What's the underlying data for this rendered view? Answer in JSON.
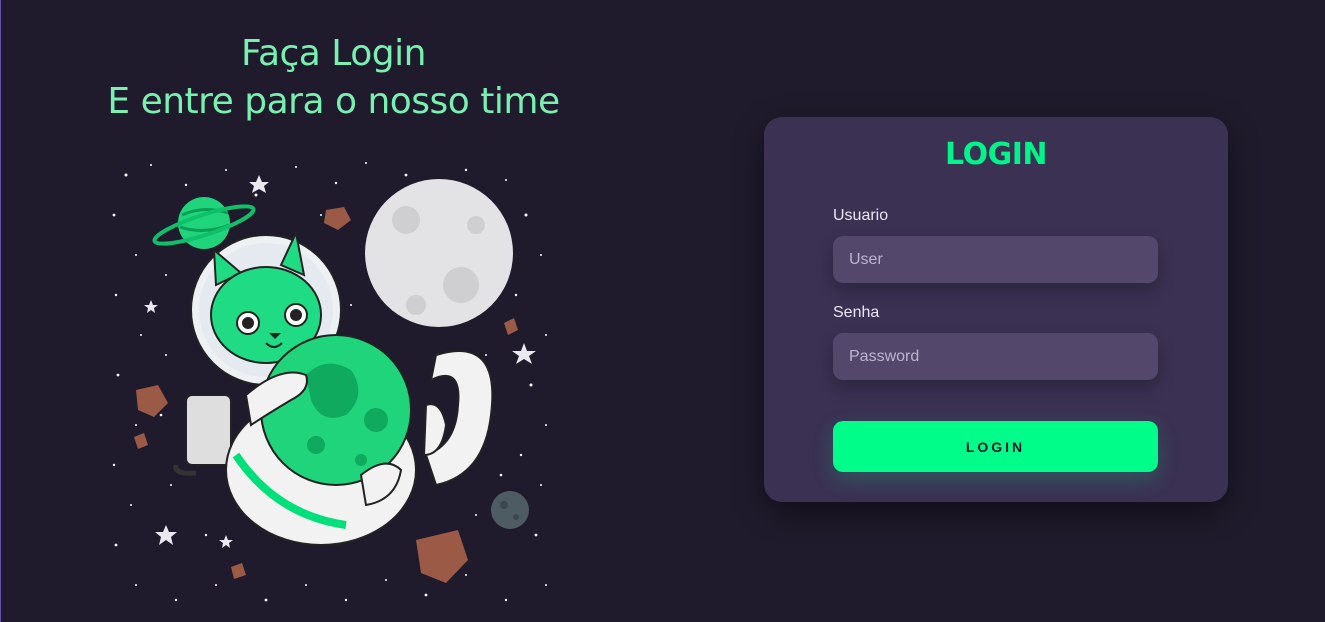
{
  "headline": {
    "line1": "Faça Login",
    "line2": "E entre para o nosso time"
  },
  "login_card": {
    "title": "LOGIN",
    "username": {
      "label": "Usuario",
      "value": "",
      "placeholder": "User"
    },
    "password": {
      "label": "Senha",
      "value": "",
      "placeholder": "Password"
    },
    "submit_label": "LOGIN"
  },
  "colors": {
    "background": "#1f1b2c",
    "headline": "#77f0b0",
    "card": "#3b3153",
    "input": "#53476b",
    "accent": "#00fd8a"
  },
  "illustration": {
    "icon": "astronaut-cat-illustration"
  }
}
